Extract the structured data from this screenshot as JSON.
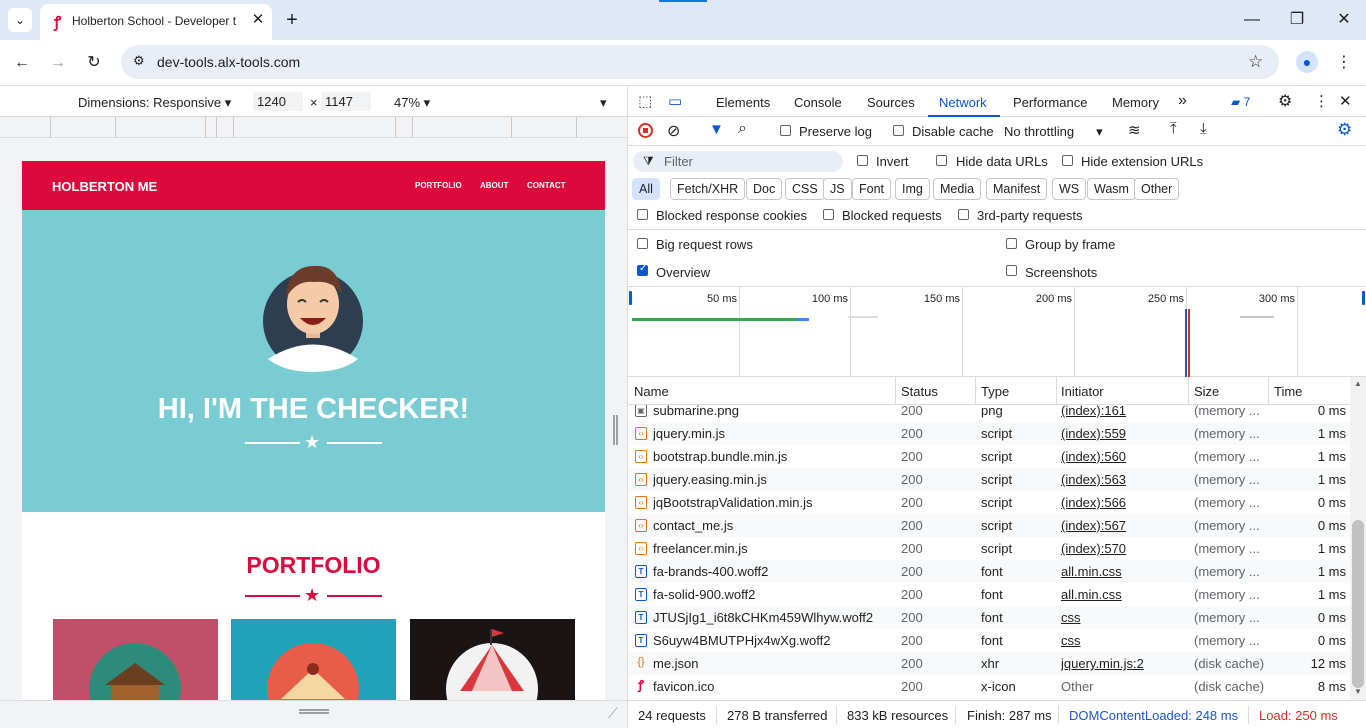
{
  "browser": {
    "tab_title": "Holberton School - Developer t",
    "url": "dev-tools.alx-tools.com"
  },
  "device_toolbar": {
    "dimensions_label": "Dimensions: Responsive",
    "width": "1240",
    "times": "×",
    "height": "1147",
    "zoom": "47%"
  },
  "site": {
    "brand": "HOLBERTON ME",
    "nav": [
      "PORTFOLIO",
      "ABOUT",
      "CONTACT"
    ],
    "hero_title": "HI, I'M THE CHECKER!",
    "portfolio_title": "PORTFOLIO",
    "colors": {
      "primary": "#dc0a3c",
      "hero": "#78ccd2"
    }
  },
  "devtools": {
    "tabs": [
      "Elements",
      "Console",
      "Sources",
      "Network",
      "Performance",
      "Memory"
    ],
    "active_tab": "Network",
    "issues_count": "7",
    "toolbar": {
      "preserve_log": "Preserve log",
      "disable_cache": "Disable cache",
      "throttling": "No throttling"
    },
    "filter": {
      "placeholder": "Filter",
      "invert": "Invert",
      "hide_data_urls": "Hide data URLs",
      "hide_extension_urls": "Hide extension URLs"
    },
    "type_chips": [
      "All",
      "Fetch/XHR",
      "Doc",
      "CSS",
      "JS",
      "Font",
      "Img",
      "Media",
      "Manifest",
      "WS",
      "Wasm",
      "Other"
    ],
    "blocked": {
      "cookies": "Blocked response cookies",
      "requests": "Blocked requests",
      "third_party": "3rd-party requests"
    },
    "settings": {
      "big_rows": "Big request rows",
      "group_by_frame": "Group by frame",
      "overview": "Overview",
      "screenshots": "Screenshots"
    },
    "overview_ticks": [
      "50 ms",
      "100 ms",
      "150 ms",
      "200 ms",
      "250 ms",
      "300 ms"
    ],
    "columns": [
      "Name",
      "Status",
      "Type",
      "Initiator",
      "Size",
      "Time"
    ],
    "rows": [
      {
        "name": "submarine.png",
        "status": "200",
        "type": "png",
        "initiator": "(index):161",
        "size": "(memory ...",
        "time": "0 ms",
        "icon": "img"
      },
      {
        "name": "jquery.min.js",
        "status": "200",
        "type": "script",
        "initiator": "(index):559",
        "size": "(memory ...",
        "time": "1 ms",
        "icon": "script"
      },
      {
        "name": "bootstrap.bundle.min.js",
        "status": "200",
        "type": "script",
        "initiator": "(index):560",
        "size": "(memory ...",
        "time": "1 ms",
        "icon": "script"
      },
      {
        "name": "jquery.easing.min.js",
        "status": "200",
        "type": "script",
        "initiator": "(index):563",
        "size": "(memory ...",
        "time": "1 ms",
        "icon": "script"
      },
      {
        "name": "jqBootstrapValidation.min.js",
        "status": "200",
        "type": "script",
        "initiator": "(index):566",
        "size": "(memory ...",
        "time": "0 ms",
        "icon": "script"
      },
      {
        "name": "contact_me.js",
        "status": "200",
        "type": "script",
        "initiator": "(index):567",
        "size": "(memory ...",
        "time": "0 ms",
        "icon": "script"
      },
      {
        "name": "freelancer.min.js",
        "status": "200",
        "type": "script",
        "initiator": "(index):570",
        "size": "(memory ...",
        "time": "1 ms",
        "icon": "script"
      },
      {
        "name": "fa-brands-400.woff2",
        "status": "200",
        "type": "font",
        "initiator": "all.min.css",
        "size": "(memory ...",
        "time": "1 ms",
        "icon": "font"
      },
      {
        "name": "fa-solid-900.woff2",
        "status": "200",
        "type": "font",
        "initiator": "all.min.css",
        "size": "(memory ...",
        "time": "1 ms",
        "icon": "font"
      },
      {
        "name": "JTUSjIg1_i6t8kCHKm459Wlhyw.woff2",
        "status": "200",
        "type": "font",
        "initiator": "css",
        "size": "(memory ...",
        "time": "0 ms",
        "icon": "font"
      },
      {
        "name": "S6uyw4BMUTPHjx4wXg.woff2",
        "status": "200",
        "type": "font",
        "initiator": "css",
        "size": "(memory ...",
        "time": "0 ms",
        "icon": "font"
      },
      {
        "name": "me.json",
        "status": "200",
        "type": "xhr",
        "initiator": "jquery.min.js:2",
        "size": "(disk cache)",
        "time": "12 ms",
        "icon": "xhr"
      },
      {
        "name": "favicon.ico",
        "status": "200",
        "type": "x-icon",
        "initiator": "Other",
        "size": "(disk cache)",
        "time": "8 ms",
        "icon": "favicon"
      }
    ],
    "status_bar": {
      "requests": "24 requests",
      "transferred": "278 B transferred",
      "resources": "833 kB resources",
      "finish": "Finish: 287 ms",
      "dom_content_loaded": "DOMContentLoaded: 248 ms",
      "load": "Load: 250 ms",
      "colors": {
        "dcl": "#1a56c9",
        "load": "#d93025"
      }
    }
  }
}
